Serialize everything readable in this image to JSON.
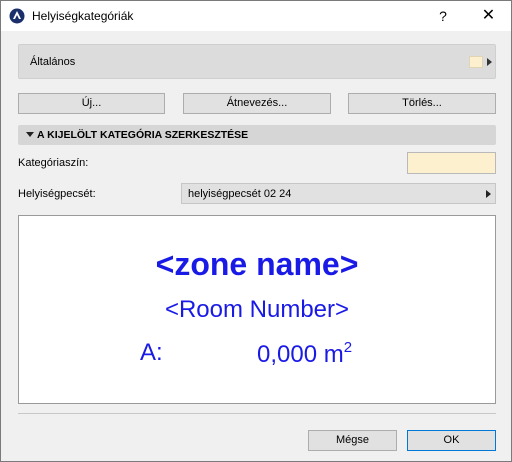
{
  "window": {
    "title": "Helyiségkategóriák",
    "help_label": "?",
    "close_label": "✕"
  },
  "category_bar": {
    "selected": "Általános",
    "swatch_color": "#fdf0cf"
  },
  "actions": {
    "new_label": "Új...",
    "rename_label": "Átnevezés...",
    "delete_label": "Törlés..."
  },
  "section": {
    "title": "A KIJELÖLT KATEGÓRIA SZERKESZTÉSE"
  },
  "fields": {
    "color_label": "Kategóriaszín:",
    "color_value": "#fdf0cf",
    "stamp_label": "Helyiségpecsét:",
    "stamp_value": "helyiségpecsét 02 24"
  },
  "preview": {
    "zone_name": "<zone name>",
    "room_number": "<Room Number>",
    "area_label": "A:",
    "area_value": "0,000 m",
    "area_unit_exp": "2",
    "text_color": "#1a1ae6"
  },
  "footer": {
    "cancel_label": "Mégse",
    "ok_label": "OK"
  }
}
